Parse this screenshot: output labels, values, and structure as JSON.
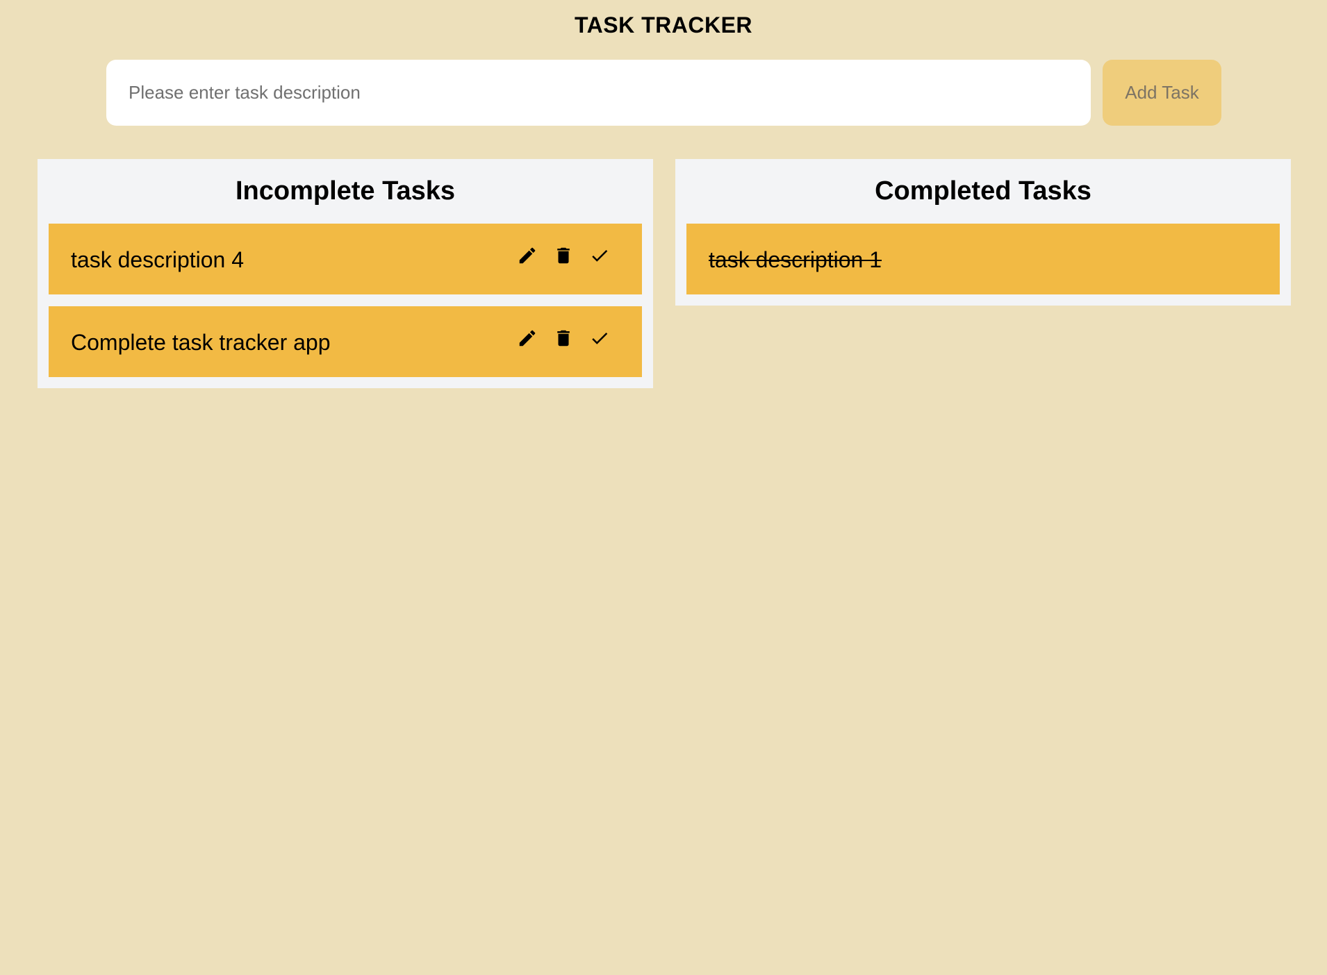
{
  "header": {
    "title": "TASK TRACKER"
  },
  "add_form": {
    "placeholder": "Please enter task description",
    "value": "",
    "button_label": "Add Task"
  },
  "incomplete": {
    "heading": "Incomplete Tasks",
    "tasks": [
      {
        "text": "task description 4",
        "actions": [
          "pencil-icon",
          "trash-icon",
          "check-icon"
        ]
      },
      {
        "text": "Complete task tracker app",
        "actions": [
          "pencil-icon",
          "trash-icon",
          "check-icon"
        ]
      }
    ]
  },
  "completed": {
    "heading": "Completed Tasks",
    "tasks": [
      {
        "text": "task description 1",
        "struck_through": true
      }
    ]
  },
  "colors": {
    "page_background": "#ede0bb",
    "panel_background": "#f3f4f6",
    "task_card": "#f2ba44",
    "add_button": "#efcd7c",
    "input_background": "#ffffff"
  }
}
